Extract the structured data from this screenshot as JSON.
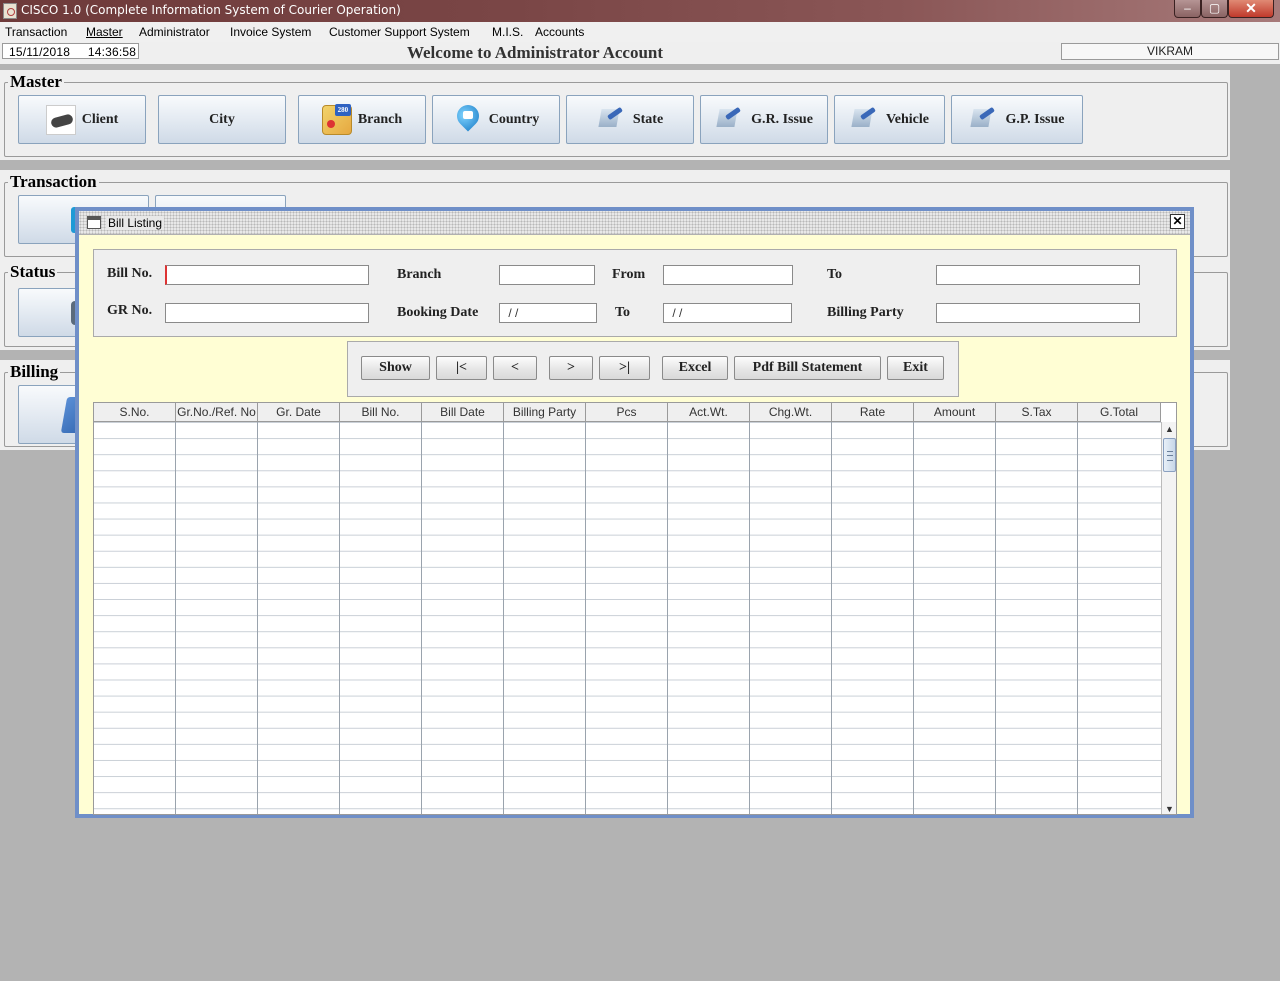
{
  "window": {
    "title": "CISCO 1.0 (Complete Information System of Courier Operation)",
    "minimize": "–",
    "maximize": "▢",
    "close": "✕"
  },
  "menu": [
    "Transaction",
    "Master",
    "Administrator",
    "Invoice System",
    "Customer Support System",
    "M.I.S.",
    "Accounts"
  ],
  "status": {
    "datetime": "15/11/2018     14:36:58",
    "welcome": "Welcome to Administrator Account",
    "user": "VIKRAM"
  },
  "master": {
    "legend": "Master",
    "tiles": [
      {
        "label": "Client",
        "icon": "handshake-icon"
      },
      {
        "label": "City",
        "icon": ""
      },
      {
        "label": "Branch",
        "icon": "road-map-icon"
      },
      {
        "label": "Country",
        "icon": "location-pin-icon"
      },
      {
        "label": "State",
        "icon": "pen-edit-icon"
      },
      {
        "label": "G.R. Issue",
        "icon": "pen-edit-icon"
      },
      {
        "label": "Vehicle",
        "icon": "pen-edit-icon"
      },
      {
        "label": "G.P. Issue",
        "icon": "pen-edit-icon"
      }
    ]
  },
  "transaction": {
    "legend": "Transaction"
  },
  "status_panel": {
    "legend": "Status"
  },
  "billing": {
    "legend": "Billing"
  },
  "bill_listing": {
    "title": "Bill Listing",
    "close": "✕",
    "fields": {
      "bill_no": {
        "label": "Bill No.",
        "value": ""
      },
      "branch": {
        "label": "Branch",
        "value": ""
      },
      "from": {
        "label": "From",
        "value": ""
      },
      "to": {
        "label": "To",
        "value": ""
      },
      "gr_no": {
        "label": "GR No.",
        "value": ""
      },
      "booking_date": {
        "label": "Booking Date",
        "value": " / /"
      },
      "to_date": {
        "label": "To",
        "value": " / /"
      },
      "billing_party": {
        "label": "Billing Party",
        "value": ""
      }
    },
    "buttons": {
      "show": "Show",
      "first": "|<",
      "prev": "<",
      "next": ">",
      "last": ">|",
      "excel": "Excel",
      "pdf": "Pdf Bill Statement",
      "exit": "Exit"
    },
    "columns": [
      "S.No.",
      "Gr.No./Ref. No",
      "Gr. Date",
      "Bill No.",
      "Bill Date",
      "Billing Party",
      "Pcs",
      "Act.Wt.",
      "Chg.Wt.",
      "Rate",
      "Amount",
      "S.Tax",
      "G.Total"
    ],
    "rows": [],
    "scroll": {
      "up": "▲",
      "down": "▼"
    }
  }
}
